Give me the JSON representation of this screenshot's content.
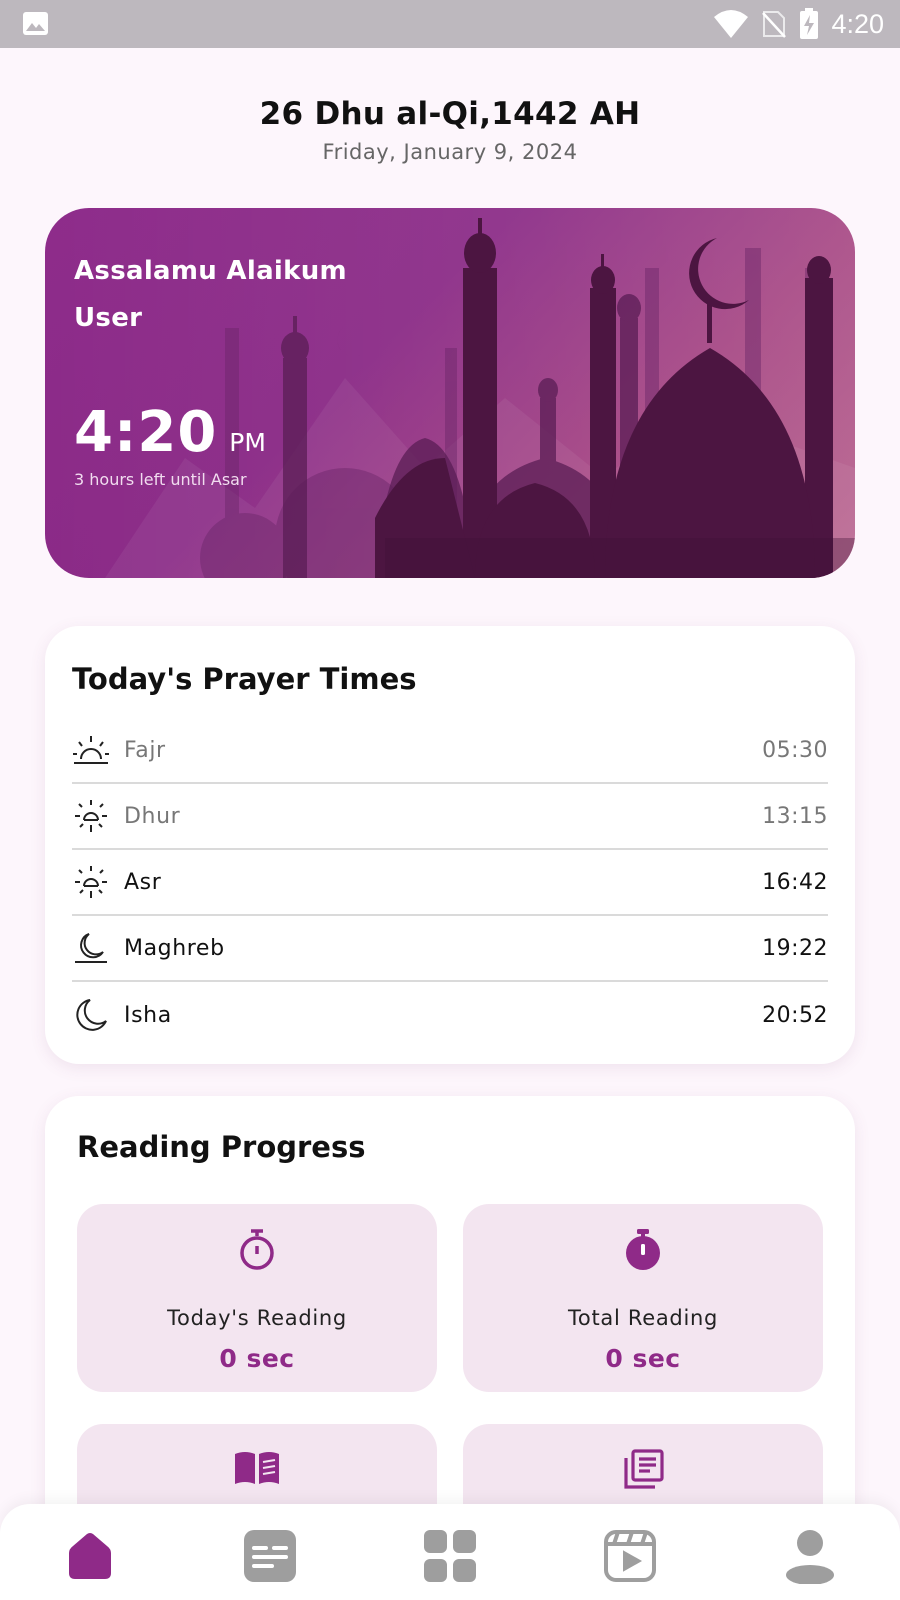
{
  "status_bar": {
    "time": "4:20"
  },
  "header": {
    "hijri_date": "26 Dhu al-Qi,1442 AH",
    "gregorian_date": "Friday, January 9, 2024"
  },
  "hero": {
    "greeting": "Assalamu Alaikum",
    "user": "User",
    "time": "4:20",
    "ampm": "PM",
    "countdown": "3 hours left until Asar"
  },
  "prayer_times": {
    "title": "Today's Prayer Times",
    "items": [
      {
        "name": "Fajr",
        "time": "05:30",
        "icon": "sunrise-icon",
        "passed": true
      },
      {
        "name": "Dhur",
        "time": "13:15",
        "icon": "sun-icon",
        "passed": true
      },
      {
        "name": "Asr",
        "time": "16:42",
        "icon": "sun-icon",
        "passed": false
      },
      {
        "name": "Maghreb",
        "time": "19:22",
        "icon": "moonset-icon",
        "passed": false
      },
      {
        "name": "Isha",
        "time": "20:52",
        "icon": "moon-icon",
        "passed": false
      }
    ]
  },
  "reading_progress": {
    "title": "Reading Progress",
    "stats": [
      {
        "label": "Today's Reading",
        "value": "0 sec",
        "icon": "stopwatch-outline-icon"
      },
      {
        "label": "Total Reading",
        "value": "0 sec",
        "icon": "stopwatch-filled-icon"
      },
      {
        "icon": "open-book-icon"
      },
      {
        "icon": "newspaper-icon"
      }
    ]
  },
  "bottom_nav": {
    "items": [
      {
        "icon": "home-icon",
        "active": true
      },
      {
        "icon": "articles-icon",
        "active": false
      },
      {
        "icon": "grid-icon",
        "active": false
      },
      {
        "icon": "video-icon",
        "active": false
      },
      {
        "icon": "profile-icon",
        "active": false
      }
    ]
  },
  "colors": {
    "accent": "#8f2a88",
    "background": "#fdf6fc",
    "stat_box": "#f3e5f0",
    "inactive_icon": "#9e9e9e"
  }
}
